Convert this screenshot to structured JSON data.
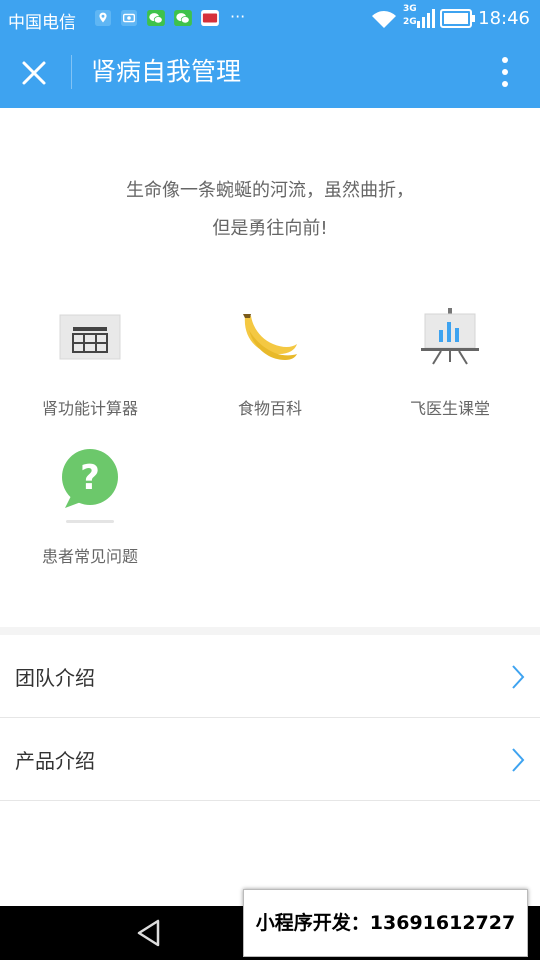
{
  "status_bar": {
    "carrier": "中国电信",
    "network_3g": "3G",
    "network_2g": "2G",
    "time": "18:46",
    "more_notifications": "···"
  },
  "app_bar": {
    "title": "肾病自我管理",
    "close_icon": "close-icon",
    "more_icon": "more-vertical-icon"
  },
  "motto": {
    "line1": "生命像一条蜿蜒的河流，虽然曲折，",
    "line2": "但是勇往向前!"
  },
  "grid": [
    {
      "label": "肾功能计算器",
      "icon": "calculator-icon"
    },
    {
      "label": "食物百科",
      "icon": "banana-icon"
    },
    {
      "label": "飞医生课堂",
      "icon": "presentation-board-icon"
    },
    {
      "label": "患者常见问题",
      "icon": "question-bubble-icon"
    }
  ],
  "list": [
    {
      "label": "团队介绍"
    },
    {
      "label": "产品介绍"
    }
  ],
  "watermark": {
    "text": "小程序开发：13691612727"
  },
  "colors": {
    "primary": "#3ea3f0",
    "text": "#333333",
    "subtext": "#666666",
    "chevron": "#3ea3f0"
  }
}
